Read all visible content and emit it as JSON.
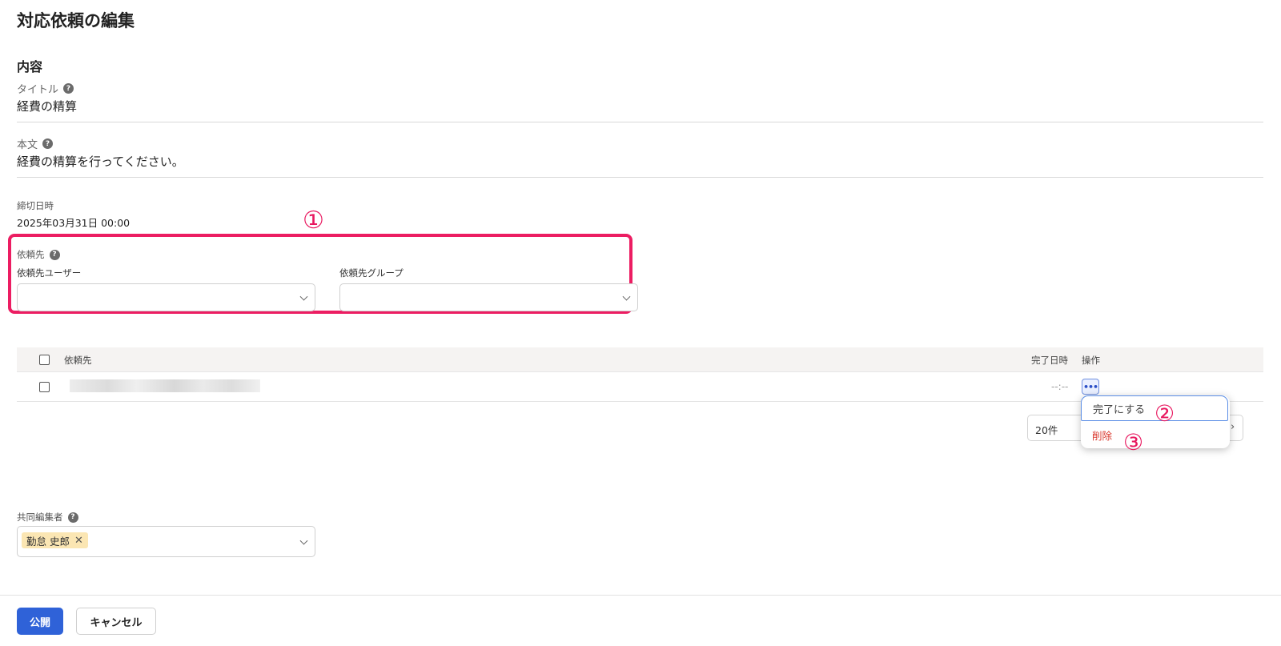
{
  "page": {
    "title": "対応依頼の編集",
    "section_title": "内容"
  },
  "fields": {
    "title_label": "タイトル",
    "title_value": "経費の精算",
    "body_label": "本文",
    "body_value": "経費の精算を行ってください。",
    "deadline_label": "締切日時",
    "deadline_value": "2025年03月31日 00:00",
    "recipient_label": "依頼先",
    "recipient_user_label": "依頼先ユーザー",
    "recipient_group_label": "依頼先グループ",
    "coeditor_label": "共同編集者",
    "coeditor_chip": "勤怠 史郎",
    "help_icon": "?"
  },
  "annotations": {
    "one": "①",
    "two": "②",
    "three": "③"
  },
  "table": {
    "col_recipient": "依頼先",
    "col_completed_at": "完了日時",
    "col_actions": "操作",
    "row_completed_at": "--:--",
    "ellipsis": "•••"
  },
  "menu": {
    "complete": "完了にする",
    "delete": "削除"
  },
  "pager": {
    "per_page": "20件"
  },
  "footer": {
    "publish": "公開",
    "cancel": "キャンセル"
  },
  "colors": {
    "annotation_red": "#e8185f",
    "primary_blue": "#2f62d8",
    "delete_red": "#d9352a",
    "chip_yellow": "#fbe6b3"
  }
}
